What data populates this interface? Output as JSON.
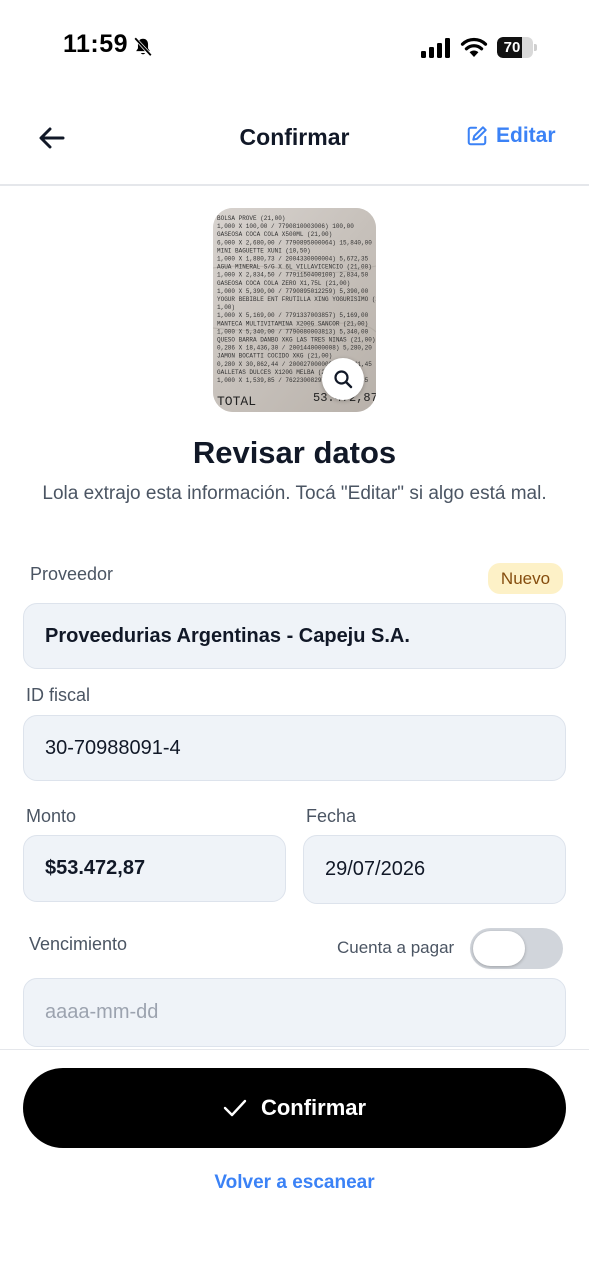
{
  "status_bar": {
    "time": "11:59",
    "battery_percent": "70",
    "battery_level": 0.7
  },
  "header": {
    "title": "Confirmar",
    "edit_label": "Editar"
  },
  "receipt": {
    "lines": [
      "BOLSA PROVE (21,00)",
      "1,000 X 100,00 / 7790810003006)        100,00",
      "GASEOSA COCA COLA X500ML (21,00)",
      "6,000 X 2,680,00 / 7790895000064)   15,840,00",
      "MINI BAGUETTE XUNI (10,50)",
      "1,000 X 1,880,73 / 2004330000004)    5,672,35",
      "AGUA MINERAL S/G X 6L VILLAVICENCIO (21,00)",
      "1,000 X 2,834,50 / 7791150400100)    2,834,50",
      "GASEOSA COCA COLA ZERO X1,75L (21,00)",
      "1,000 X 5,390,00 / 7790895012259)    5,390,00",
      "YOGUR BEBIBLE ENT FRUTILLA XING YOGURISIMO (2",
      "1,00)",
      "1,000 X 5,169,00 / 7791337003857)    5,169,00",
      "MANTECA MULTIVITAMINA X200G SANCOR (21,00)",
      "1,000 X 5,340,00 / 7790080003813)    5,340,00",
      "QUESO BARRA DANBO XKG LAS TRES NINAS (21,00)",
      "0,286 X 18,436,30 / 2001440000008)   5,280,20",
      "JAMON BOCATTI COCIDO XKG (21,00)",
      "0,280 X 30,862,44 / 2000270000009)   8,641,45",
      "GALLETAS DULCES X120G MELBA (21,00)",
      "1,000 X 1,539,85 / 7622300829758)    1,539,85"
    ],
    "total_label": "TOTAL",
    "total_value": "53.472,87"
  },
  "intro": {
    "heading": "Revisar datos",
    "subtitle": "Lola extrajo esta información. Tocá \"Editar\" si algo está mal."
  },
  "form": {
    "provider": {
      "label": "Proveedor",
      "badge": "Nuevo",
      "value": "Proveedurias Argentinas - Capeju S.A."
    },
    "tax_id": {
      "label": "ID fiscal",
      "value": "30-70988091-4"
    },
    "amount": {
      "label": "Monto",
      "value": "$53.472,87"
    },
    "date": {
      "label": "Fecha",
      "value": "29/07/2026"
    },
    "due": {
      "label": "Vencimiento",
      "placeholder": "aaaa-mm-dd",
      "toggle_label": "Cuenta a pagar",
      "toggle_on": false
    }
  },
  "actions": {
    "confirm_label": "Confirmar",
    "rescan_label": "Volver a escanear"
  },
  "colors": {
    "accent": "#3b82f6",
    "field_bg": "#eff3f8",
    "badge_bg": "#fdf1c7",
    "badge_text": "#854d0e",
    "button_bg": "#000000"
  },
  "icons": [
    "bell-slash-icon",
    "cellular-signal-icon",
    "wifi-icon",
    "battery-icon",
    "back-arrow-icon",
    "edit-icon",
    "zoom-icon",
    "check-icon"
  ]
}
